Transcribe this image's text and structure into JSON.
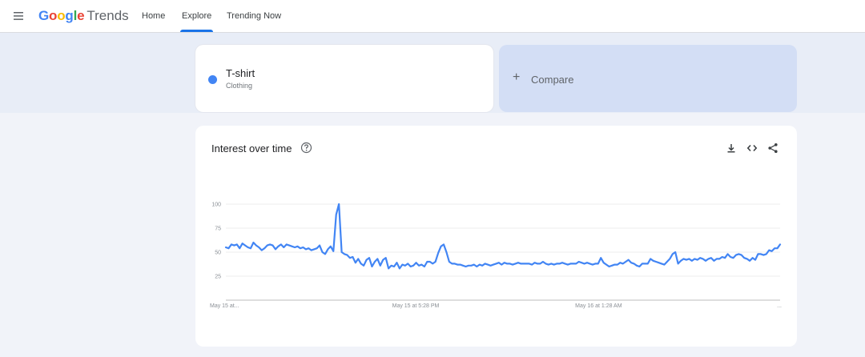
{
  "header": {
    "logo_brand": "Google",
    "logo_product": "Trends",
    "nav": [
      {
        "label": "Home",
        "active": false
      },
      {
        "label": "Explore",
        "active": true
      },
      {
        "label": "Trending Now",
        "active": false
      }
    ]
  },
  "search_term": {
    "name": "T-shirt",
    "category": "Clothing",
    "color": "#4285f4"
  },
  "compare": {
    "plus": "+",
    "label": "Compare"
  },
  "interest_card": {
    "title": "Interest over time",
    "icons": [
      "help-icon",
      "download-icon",
      "embed-icon",
      "share-icon"
    ]
  },
  "chart_data": {
    "type": "line",
    "title": "",
    "xlabel": "",
    "ylabel": "",
    "y_ticks": [
      100,
      75,
      50,
      25
    ],
    "ylim": [
      0,
      100
    ],
    "x_tick_labels": [
      "May 15 at...",
      "May 15 at 5:28 PM",
      "May 16 at 1:28 AM",
      "..."
    ],
    "grid": true,
    "series": [
      {
        "color": "#4285f4",
        "values": [
          55,
          54,
          58,
          57,
          58,
          54,
          59,
          57,
          55,
          54,
          60,
          57,
          55,
          52,
          54,
          57,
          58,
          57,
          53,
          56,
          58,
          55,
          58,
          57,
          56,
          55,
          56,
          54,
          55,
          53,
          54,
          52,
          53,
          54,
          57,
          50,
          48,
          53,
          56,
          51,
          89,
          100,
          50,
          48,
          47,
          44,
          45,
          39,
          43,
          38,
          36,
          42,
          44,
          35,
          40,
          43,
          36,
          42,
          44,
          33,
          36,
          35,
          39,
          33,
          37,
          36,
          38,
          35,
          36,
          39,
          36,
          37,
          35,
          40,
          40,
          38,
          40,
          49,
          56,
          58,
          50,
          40,
          38,
          38,
          37,
          37,
          36,
          35,
          36,
          36,
          37,
          35,
          37,
          36,
          38,
          37,
          36,
          37,
          38,
          39,
          37,
          39,
          38,
          38,
          37,
          38,
          39,
          38,
          38,
          38,
          38,
          37,
          39,
          38,
          38,
          40,
          38,
          37,
          38,
          37,
          38,
          38,
          39,
          38,
          37,
          38,
          38,
          38,
          40,
          39,
          38,
          39,
          38,
          37,
          38,
          38,
          44,
          39,
          37,
          35,
          36,
          37,
          37,
          39,
          38,
          40,
          42,
          39,
          38,
          36,
          35,
          38,
          38,
          38,
          43,
          41,
          40,
          39,
          38,
          37,
          40,
          43,
          48,
          50,
          38,
          41,
          43,
          42,
          43,
          41,
          43,
          42,
          44,
          43,
          41,
          43,
          44,
          41,
          43,
          43,
          45,
          44,
          48,
          45,
          44,
          47,
          48,
          47,
          44,
          43,
          41,
          44,
          42,
          48,
          48,
          47,
          48,
          52,
          51,
          54,
          54,
          58
        ]
      }
    ]
  }
}
